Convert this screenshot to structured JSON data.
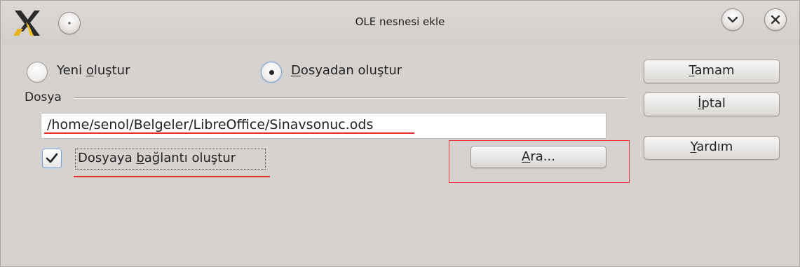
{
  "window": {
    "title": "OLE nesnesi ekle"
  },
  "source_options": [
    {
      "label_pre": "Yeni ",
      "label_mnemonic": "o",
      "label_post": "luştur",
      "selected": false
    },
    {
      "label_pre": "",
      "label_mnemonic": "D",
      "label_post": "osyadan oluştur",
      "selected": true
    }
  ],
  "file_group": {
    "title": "Dosya",
    "path_value": "/home/senol/Belgeler/LibreOffice/Sinavsonuc.ods",
    "link_checkbox": {
      "label_pre": "Dosyaya ",
      "label_mnemonic": "b",
      "label_post": "ağlantı oluştur",
      "checked": true
    },
    "browse_button": {
      "label_mnemonic": "A",
      "label_post": "ra..."
    }
  },
  "buttons": {
    "ok": {
      "label_mnemonic": "T",
      "label_post": "amam"
    },
    "cancel": {
      "label_mnemonic": "İ",
      "label_post": "ptal"
    },
    "help": {
      "label_mnemonic": "Y",
      "label_post": "ardım"
    }
  },
  "colors": {
    "window_bg": "#d6d2d0",
    "annotation_red": "#e53030",
    "focus_blue": "#7fa0c4"
  }
}
